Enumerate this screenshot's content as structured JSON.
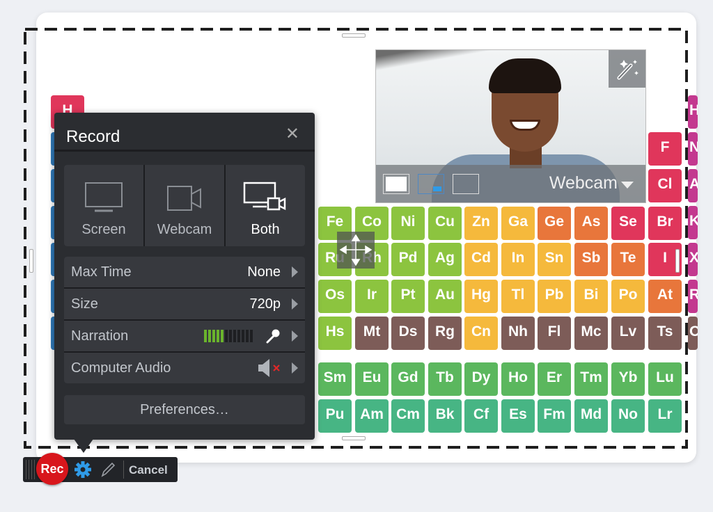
{
  "colors": {
    "transition": "#8cc43f",
    "post_transition": "#f5b93c",
    "metalloid": "#e8763b",
    "nonmetal": "#e0365b",
    "unknown": "#7d5c58",
    "lanthanide": "#5bb75e",
    "actinide": "#47b584",
    "noble": "#c3388f",
    "hydrogen": "#e0365b",
    "alkali": "#3079b8",
    "accent": "#2f9be8",
    "rec": "#d8161c"
  },
  "elements": [
    [
      [
        "Fe",
        "transition"
      ],
      [
        "Co",
        "transition"
      ],
      [
        "Ni",
        "transition"
      ],
      [
        "Cu",
        "transition"
      ],
      [
        "Zn",
        "post_transition"
      ],
      [
        "Ga",
        "post_transition"
      ],
      [
        "Ge",
        "metalloid"
      ],
      [
        "As",
        "metalloid"
      ],
      [
        "Se",
        "nonmetal"
      ],
      [
        "Br",
        "nonmetal"
      ]
    ],
    [
      [
        "Ru",
        "transition"
      ],
      [
        "Rh",
        "transition"
      ],
      [
        "Pd",
        "transition"
      ],
      [
        "Ag",
        "transition"
      ],
      [
        "Cd",
        "post_transition"
      ],
      [
        "In",
        "post_transition"
      ],
      [
        "Sn",
        "post_transition"
      ],
      [
        "Sb",
        "metalloid"
      ],
      [
        "Te",
        "metalloid"
      ],
      [
        "I",
        "nonmetal"
      ]
    ],
    [
      [
        "Os",
        "transition"
      ],
      [
        "Ir",
        "transition"
      ],
      [
        "Pt",
        "transition"
      ],
      [
        "Au",
        "transition"
      ],
      [
        "Hg",
        "post_transition"
      ],
      [
        "Tl",
        "post_transition"
      ],
      [
        "Pb",
        "post_transition"
      ],
      [
        "Bi",
        "post_transition"
      ],
      [
        "Po",
        "post_transition"
      ],
      [
        "At",
        "metalloid"
      ]
    ],
    [
      [
        "Hs",
        "transition"
      ],
      [
        "Mt",
        "unknown"
      ],
      [
        "Ds",
        "unknown"
      ],
      [
        "Rg",
        "unknown"
      ],
      [
        "Cn",
        "post_transition"
      ],
      [
        "Nh",
        "unknown"
      ],
      [
        "Fl",
        "unknown"
      ],
      [
        "Mc",
        "unknown"
      ],
      [
        "Lv",
        "unknown"
      ],
      [
        "Ts",
        "unknown"
      ]
    ],
    [
      [
        "Sm",
        "lanthanide"
      ],
      [
        "Eu",
        "lanthanide"
      ],
      [
        "Gd",
        "lanthanide"
      ],
      [
        "Tb",
        "lanthanide"
      ],
      [
        "Dy",
        "lanthanide"
      ],
      [
        "Ho",
        "lanthanide"
      ],
      [
        "Er",
        "lanthanide"
      ],
      [
        "Tm",
        "lanthanide"
      ],
      [
        "Yb",
        "lanthanide"
      ],
      [
        "Lu",
        "lanthanide"
      ]
    ],
    [
      [
        "Pu",
        "actinide"
      ],
      [
        "Am",
        "actinide"
      ],
      [
        "Cm",
        "actinide"
      ],
      [
        "Bk",
        "actinide"
      ],
      [
        "Cf",
        "actinide"
      ],
      [
        "Es",
        "actinide"
      ],
      [
        "Fm",
        "actinide"
      ],
      [
        "Md",
        "actinide"
      ],
      [
        "No",
        "actinide"
      ],
      [
        "Lr",
        "actinide"
      ]
    ]
  ],
  "extra_elements": {
    "F": "F",
    "Cl": "Cl",
    "H": "H",
    "noble_partial": [
      "H",
      "N",
      "A",
      "K",
      "X",
      "R",
      "O"
    ]
  },
  "record_panel": {
    "title": "Record",
    "modes": [
      {
        "label": "Screen",
        "icon": "monitor-icon"
      },
      {
        "label": "Webcam",
        "icon": "camera-icon"
      },
      {
        "label": "Both",
        "icon": "monitor-camera-icon",
        "selected": true
      }
    ],
    "settings": [
      {
        "label": "Max Time",
        "value": "None"
      },
      {
        "label": "Size",
        "value": "720p"
      },
      {
        "label": "Narration",
        "meter_level": 5,
        "meter_total": 12,
        "icon": "microphone-icon"
      },
      {
        "label": "Computer Audio",
        "icon": "speaker-muted-icon"
      }
    ],
    "preferences_label": "Preferences…"
  },
  "webcam": {
    "label": "Webcam",
    "layout_selected": 1
  },
  "toolbar": {
    "rec_label": "Rec",
    "cancel_label": "Cancel"
  }
}
